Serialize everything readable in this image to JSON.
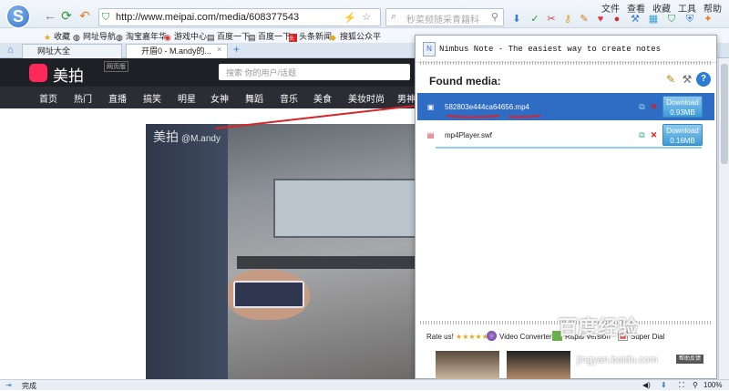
{
  "browser": {
    "url": "http://www.meipai.com/media/608377543",
    "search_placeholder": "秒菜频随采青籍科",
    "menu": [
      "文件",
      "查看",
      "收藏",
      "工具",
      "帮助"
    ],
    "favorites": [
      "收藏",
      "网址导航",
      "淘宝嘉年华",
      "游戏中心",
      "百度一下",
      "百度一下",
      "头条新闻",
      "搜狐公众平"
    ],
    "tabs": [
      "网址大全",
      "开眉0 - M.andy的..."
    ],
    "status": "完成",
    "zoom": "100%"
  },
  "site": {
    "name": "美拍",
    "version_badge": "网页版",
    "search_placeholder": "搜索 你的用户/话题",
    "nav": [
      "首页",
      "热门",
      "直播",
      "搞笑",
      "明星",
      "女神",
      "舞蹈",
      "音乐",
      "美食",
      "美妆时尚",
      "男神"
    ],
    "video_watermark_brand": "美拍",
    "video_watermark_user": "@M.andy"
  },
  "popup": {
    "title": "Nimbus Note - The easiest way to create notes",
    "found_label": "Found media:",
    "media": [
      {
        "name": "582803e444ca64656.mp4",
        "download_label": "Download",
        "size": "0.93MB",
        "selected": true
      },
      {
        "name": "mp4Player.swf",
        "download_label": "Download",
        "size": "0.16MB",
        "selected": false
      }
    ],
    "footer": {
      "rate": "Rate us!",
      "stars": "★★★★★",
      "video_converter": "Video Converter",
      "rapid": "Rapid Version",
      "super": "Super Dial"
    },
    "feedback": "帮助反馈"
  },
  "watermark": {
    "main": "百度经验",
    "sub": "jingyan.baidu.com"
  }
}
